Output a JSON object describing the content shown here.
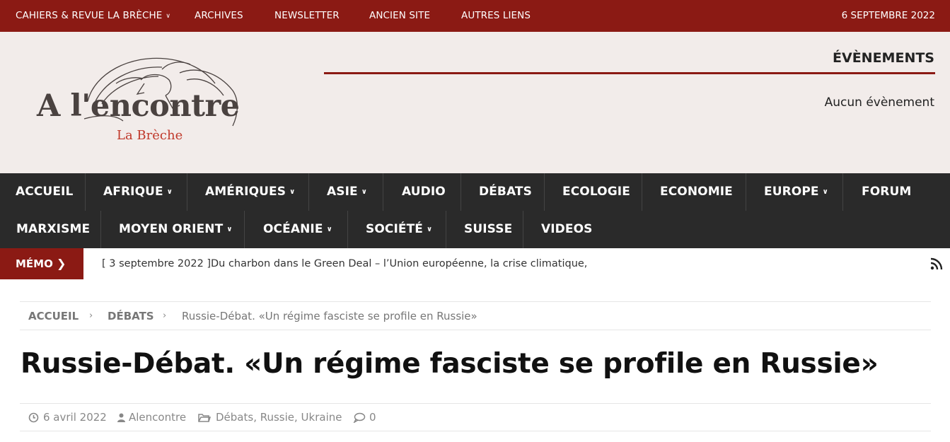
{
  "topbar": {
    "items": [
      {
        "label": "CAHIERS & REVUE LA BRÈCHE",
        "dropdown": true
      },
      {
        "label": "ARCHIVES"
      },
      {
        "label": "NEWSLETTER"
      },
      {
        "label": "ANCIEN SITE"
      },
      {
        "label": "AUTRES LIENS"
      }
    ],
    "date": "6 SEPTEMBRE 2022"
  },
  "logo": {
    "title": "A l'encontre",
    "subtitle": "La Brèche"
  },
  "events": {
    "title": "ÉVÈNEMENTS",
    "empty_text": "Aucun évènement"
  },
  "nav": {
    "items": [
      {
        "label": "ACCUEIL"
      },
      {
        "label": "AFRIQUE",
        "dropdown": true
      },
      {
        "label": "AMÉRIQUES",
        "dropdown": true
      },
      {
        "label": "ASIE",
        "dropdown": true
      },
      {
        "label": "AUDIO"
      },
      {
        "label": "DÉBATS"
      },
      {
        "label": "ECOLOGIE"
      },
      {
        "label": "ECONOMIE"
      },
      {
        "label": "EUROPE",
        "dropdown": true
      },
      {
        "label": "FORUM"
      },
      {
        "label": "MARXISME"
      },
      {
        "label": "MOYEN ORIENT",
        "dropdown": true
      },
      {
        "label": "OCÉANIE",
        "dropdown": true
      },
      {
        "label": "SOCIÉTÉ",
        "dropdown": true
      },
      {
        "label": "SUISSE"
      },
      {
        "label": "VIDEOS"
      }
    ]
  },
  "memo": {
    "label": "MÉMO",
    "date": "[ 3 septembre 2022 ]",
    "text": "Du charbon dans le Green Deal – l’Union européenne, la crise climatique,"
  },
  "breadcrumb": {
    "home": "ACCUEIL",
    "category": "DÉBATS",
    "current": "Russie-Débat. «Un régime fasciste se profile en Russie»"
  },
  "post": {
    "title": "Russie-Débat. «Un régime fasciste se profile en Russie»",
    "date": "6 avril 2022",
    "author": "Alencontre",
    "categories": "Débats, Russie, Ukraine",
    "comments": "0"
  },
  "colors": {
    "brand_red": "#8b1a14",
    "nav_bg": "#2a2a2a",
    "header_bg": "#f2ecea"
  }
}
